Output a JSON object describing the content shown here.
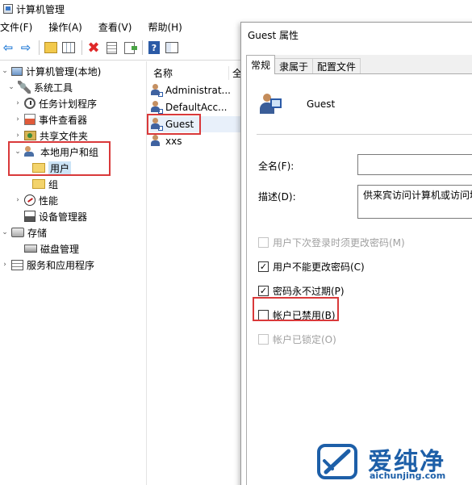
{
  "window": {
    "title": "计算机管理"
  },
  "menu": [
    "文件(F)",
    "操作(A)",
    "查看(V)",
    "帮助(H)"
  ],
  "toolbar": [
    "back-icon",
    "forward-icon",
    "up-icon",
    "show-hide-tree-icon",
    "delete-icon",
    "properties-icon",
    "export-list-icon",
    "help-icon",
    "mmc-icon"
  ],
  "tree": [
    {
      "label": "计算机管理(本地)",
      "level": 0,
      "expanded": true,
      "icon": "computer-icon"
    },
    {
      "label": "系统工具",
      "level": 1,
      "expanded": true,
      "icon": "tools-icon"
    },
    {
      "label": "任务计划程序",
      "level": 2,
      "expanded": false,
      "icon": "task-scheduler-icon"
    },
    {
      "label": "事件查看器",
      "level": 2,
      "expanded": false,
      "icon": "event-viewer-icon"
    },
    {
      "label": "共享文件夹",
      "level": 2,
      "expanded": false,
      "icon": "shared-folder-icon"
    },
    {
      "label": "本地用户和组",
      "level": 2,
      "expanded": true,
      "icon": "local-users-icon"
    },
    {
      "label": "用户",
      "level": 3,
      "selected": true,
      "icon": "folder-icon"
    },
    {
      "label": "组",
      "level": 3,
      "icon": "folder-icon"
    },
    {
      "label": "性能",
      "level": 2,
      "expanded": false,
      "icon": "performance-icon"
    },
    {
      "label": "设备管理器",
      "level": 2,
      "icon": "device-manager-icon"
    },
    {
      "label": "存储",
      "level": 1,
      "expanded": true,
      "icon": "storage-icon"
    },
    {
      "label": "磁盘管理",
      "level": 2,
      "icon": "disk-icon"
    },
    {
      "label": "服务和应用程序",
      "level": 1,
      "expanded": false,
      "icon": "services-icon"
    }
  ],
  "list": {
    "columns": [
      "名称",
      "全"
    ],
    "items": [
      "Administrat...",
      "DefaultAcc...",
      "Guest",
      "xxs"
    ]
  },
  "dialog": {
    "title": "Guest 属性",
    "tabs": [
      "常规",
      "隶属于",
      "配置文件"
    ],
    "user_name": "Guest",
    "fullname_label": "全名(F):",
    "fullname_value": "",
    "description_label": "描述(D):",
    "description_value": "供来宾访问计算机或访问域",
    "checkboxes": [
      {
        "label": "用户下次登录时须更改密码(M)",
        "checked": false,
        "disabled": true
      },
      {
        "label": "用户不能更改密码(C)",
        "checked": true,
        "disabled": false
      },
      {
        "label": "密码永不过期(P)",
        "checked": true,
        "disabled": false
      },
      {
        "label": "帐户已禁用(B)",
        "checked": false,
        "disabled": false
      },
      {
        "label": "帐户已锁定(O)",
        "checked": false,
        "disabled": true
      }
    ]
  },
  "watermark": {
    "brand": "爱纯净",
    "url": "aichunjing.com"
  },
  "colors": {
    "highlight": "#d9393a",
    "accent": "#1d5fa8",
    "selection": "#cce4f7"
  }
}
